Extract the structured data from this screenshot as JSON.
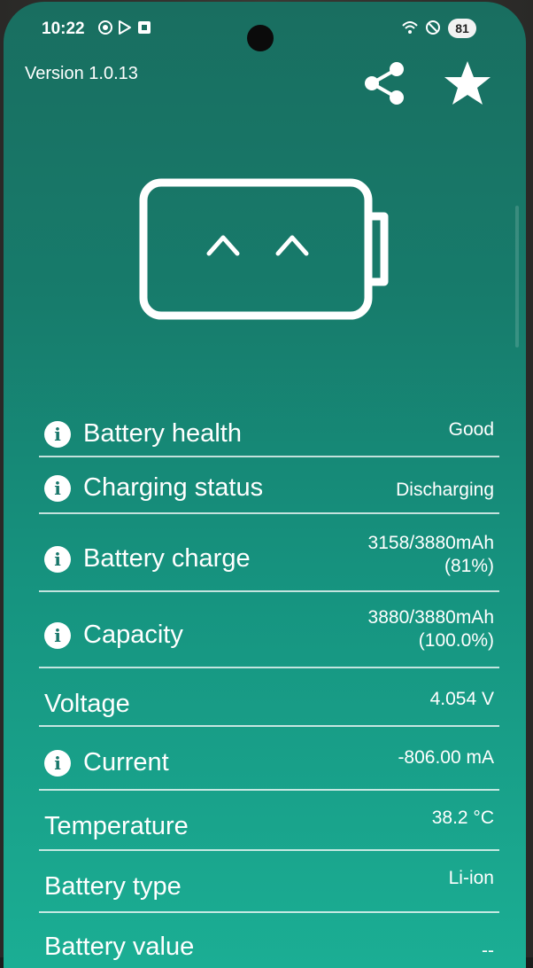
{
  "status_bar": {
    "time": "10:22",
    "battery_level": "81"
  },
  "header": {
    "version": "Version 1.0.13"
  },
  "icons": {
    "share": "share-icon",
    "star": "star-icon",
    "battery_face": "battery-face-icon",
    "info": "info-icon"
  },
  "info_symbol": "i",
  "rows": [
    {
      "label": "Battery health",
      "value_line1": "Good",
      "value_line2": ""
    },
    {
      "label": "Charging status",
      "value_line1": "Discharging",
      "value_line2": ""
    },
    {
      "label": "Battery charge",
      "value_line1": "3158/3880mAh",
      "value_line2": "(81%)"
    },
    {
      "label": "Capacity",
      "value_line1": "3880/3880mAh",
      "value_line2": "(100.0%)"
    },
    {
      "label": "Voltage",
      "value_line1": "4.054 V",
      "value_line2": ""
    },
    {
      "label": "Current",
      "value_line1": "-806.00 mA",
      "value_line2": ""
    },
    {
      "label": "Temperature",
      "value_line1": "38.2 °C",
      "value_line2": ""
    },
    {
      "label": "Battery type",
      "value_line1": "Li-ion",
      "value_line2": ""
    },
    {
      "label": "Battery value",
      "value_line1": "--",
      "value_line2": ""
    }
  ],
  "colors": {
    "accent": "#17806e",
    "text": "#ffffff"
  }
}
